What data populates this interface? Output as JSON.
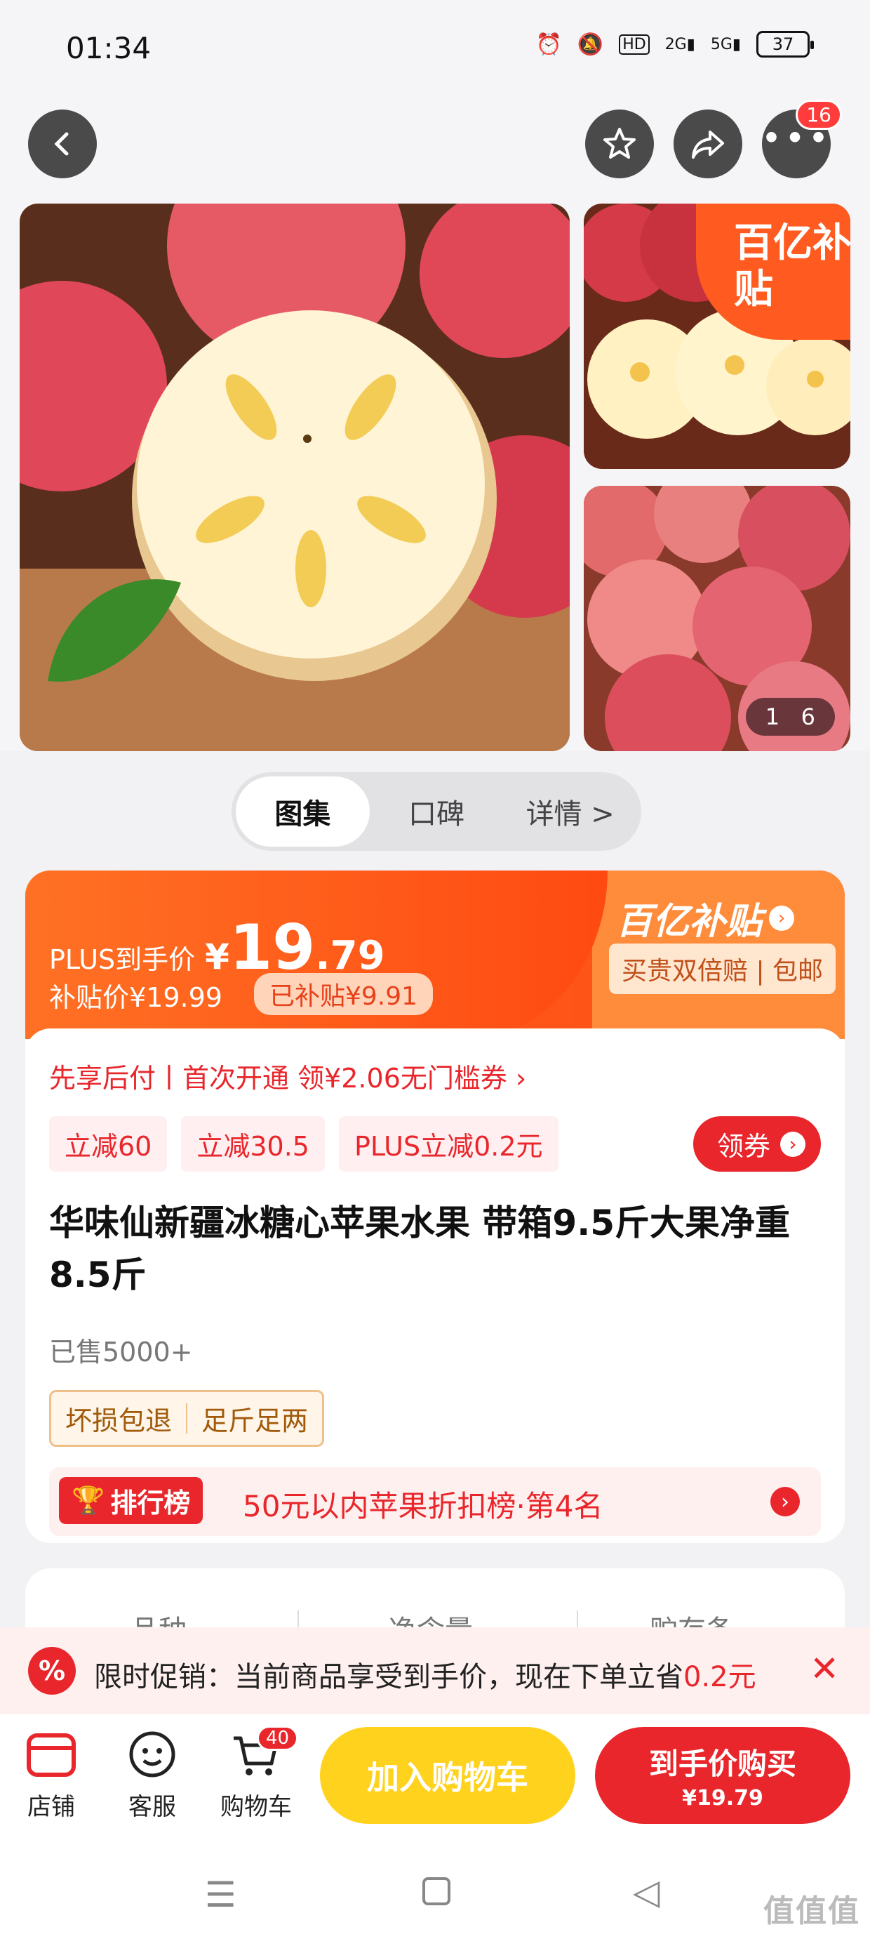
{
  "status_bar": {
    "time": "01:34",
    "battery": "37",
    "hd": "HD",
    "net1": "2G",
    "net2": "5G"
  },
  "top_badge": "16",
  "gallery": {
    "subsidy_badge": "百亿补贴",
    "counter_left": "1",
    "counter_right": "6"
  },
  "tabs": [
    "图集",
    "口碑",
    "详情 >"
  ],
  "price": {
    "plus_label": "PLUS到手价",
    "currency": "¥",
    "int": "19",
    "dec": ".79",
    "subsidy_price": "补贴价¥19.99",
    "subsidized": "已补贴¥9.91",
    "brand": "百亿补贴",
    "guarantee": "买贵双倍赔 | 包邮"
  },
  "pay_later": "先享后付丨首次开通 领¥2.06无门槛券 ›",
  "coupons": [
    "立减60",
    "立减30.5",
    "PLUS立减0.2元"
  ],
  "coupon_button": "领券",
  "title": "华味仙新疆冰糖心苹果水果 带箱9.5斤大果净重8.5斤",
  "sold": "已售5000+",
  "tags": [
    "坏损包退",
    "足斤足两"
  ],
  "rank": {
    "badge": "排行榜",
    "text": "50元以内苹果折扣榜·第4名"
  },
  "spec_headers": [
    "品种",
    "净含量",
    "贮存条"
  ],
  "promo": {
    "text": "限时促销：当前商品享受到手价，现在下单立省",
    "amount": "0.2元"
  },
  "bottom": {
    "store": "店铺",
    "service": "客服",
    "cart": "购物车",
    "cart_count": "40",
    "add_cart": "加入购物车",
    "buy_label": "到手价购买",
    "buy_price": "¥19.79"
  },
  "watermark": "值值值"
}
